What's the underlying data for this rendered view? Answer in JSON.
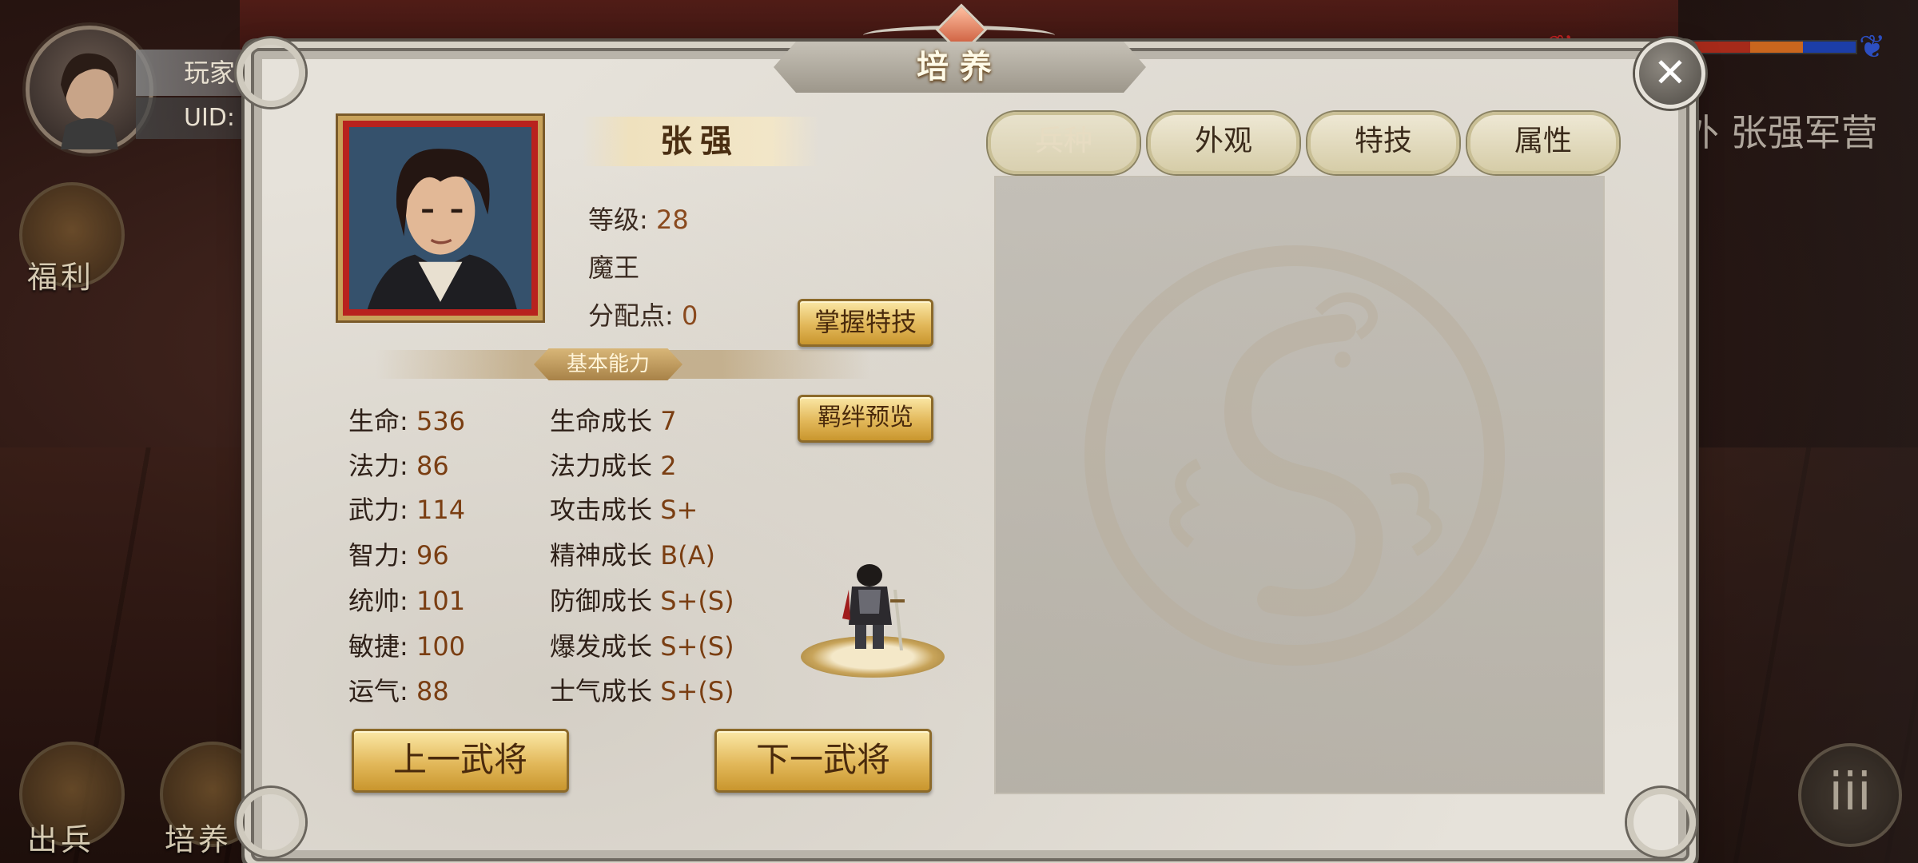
{
  "hud": {
    "player_label": "玩家",
    "uid_label": "UID:",
    "welfare_label": "福利",
    "deploy_label": "出兵",
    "train_label": "培养",
    "camp_text": "外 张强军营",
    "menu_glyph": "iii"
  },
  "dialog": {
    "title": "培养",
    "close_glyph": "✕"
  },
  "hero": {
    "name": "张强",
    "level_label": "等级:",
    "level_value": "28",
    "class": "魔王",
    "points_label": "分配点:",
    "points_value": "0"
  },
  "buttons": {
    "master_skill": "掌握特技",
    "bond_preview": "羁绊预览",
    "prev_general": "上一武将",
    "next_general": "下一武将"
  },
  "section_title": "基本能力",
  "stats_left": [
    {
      "label": "生命:",
      "value": "536"
    },
    {
      "label": "法力:",
      "value": "86"
    },
    {
      "label": "武力:",
      "value": "114"
    },
    {
      "label": "智力:",
      "value": "96"
    },
    {
      "label": "统帅:",
      "value": "101"
    },
    {
      "label": "敏捷:",
      "value": "100"
    },
    {
      "label": "运气:",
      "value": "88"
    }
  ],
  "stats_right": [
    {
      "label": "生命成长",
      "value": "7"
    },
    {
      "label": "法力成长",
      "value": "2"
    },
    {
      "label": "攻击成长",
      "value": "S+"
    },
    {
      "label": "精神成长",
      "value": "B(A)"
    },
    {
      "label": "防御成长",
      "value": "S+(S)"
    },
    {
      "label": "爆发成长",
      "value": "S+(S)"
    },
    {
      "label": "士气成长",
      "value": "S+(S)"
    }
  ],
  "tabs": [
    {
      "label": "兵种",
      "active": true
    },
    {
      "label": "外观",
      "active": false
    },
    {
      "label": "特技",
      "active": false
    },
    {
      "label": "属性",
      "active": false
    }
  ],
  "colors": {
    "accent_gold": "#e2b85a",
    "value_brown": "#7a3e12",
    "portrait_frame_red": "#b8221e"
  }
}
